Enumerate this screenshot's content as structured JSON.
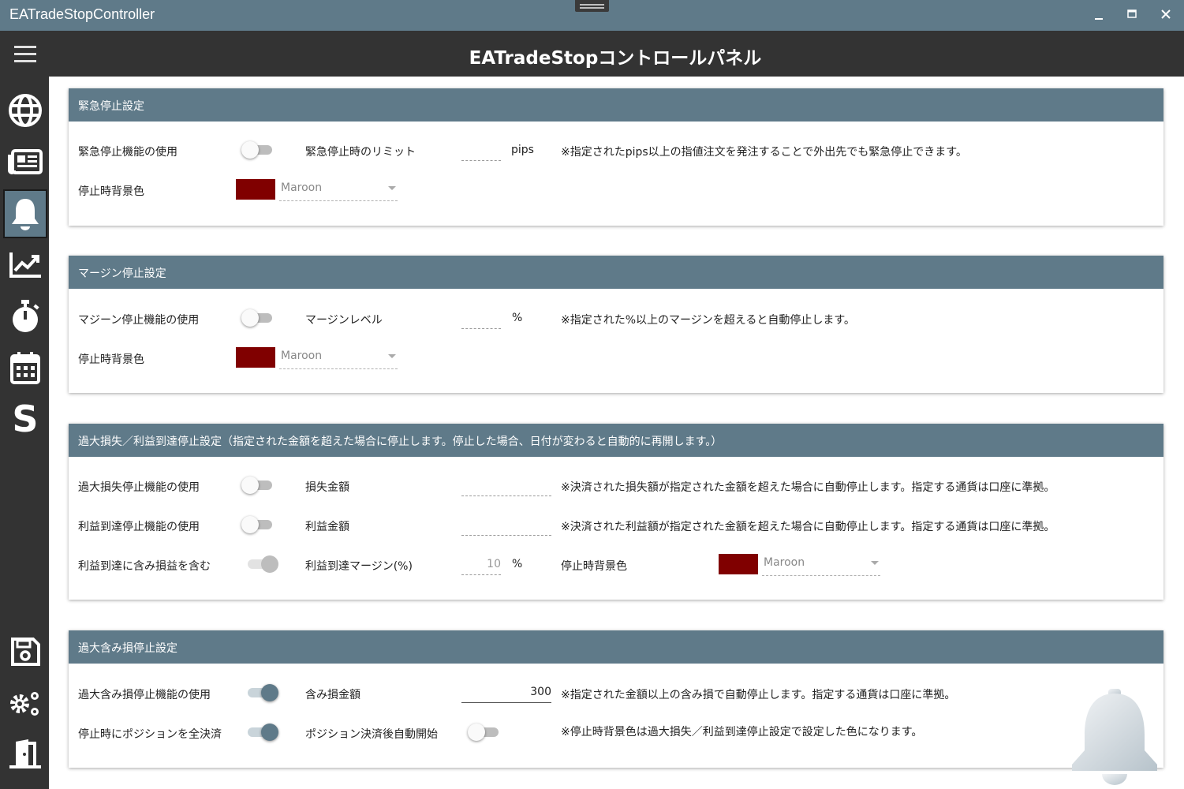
{
  "window": {
    "title": "EATradeStopController",
    "minimize": "🗕",
    "maximize": "🗖",
    "close": "✕"
  },
  "header": {
    "title": "EATradeStopコントロールパネル"
  },
  "sidebar": {
    "items": [
      {
        "icon": "globe-icon"
      },
      {
        "icon": "newspaper-icon"
      },
      {
        "icon": "bell-icon",
        "active": true
      },
      {
        "icon": "chart-line-icon"
      },
      {
        "icon": "stopwatch-icon"
      },
      {
        "icon": "calendar-icon"
      },
      {
        "icon": "s-letter-icon",
        "glyph": "S"
      }
    ],
    "bottom_items": [
      {
        "icon": "save-icon"
      },
      {
        "icon": "settings-gears-icon"
      },
      {
        "icon": "exit-door-icon"
      }
    ]
  },
  "emergency": {
    "header": "緊急停止設定",
    "use_label": "緊急停止機能の使用",
    "use_on": false,
    "limit_label": "緊急停止時のリミット",
    "limit_value": "",
    "limit_unit": "pips",
    "note": "※指定されたpips以上の指値注文を発注することで外出先でも緊急停止できます。",
    "bg_label": "停止時背景色",
    "bg_color": "#800000",
    "bg_name": "Maroon"
  },
  "margin": {
    "header": "マージン停止設定",
    "use_label": "マジーン停止機能の使用",
    "use_on": false,
    "level_label": "マージンレベル",
    "level_value": "",
    "level_unit": "%",
    "note": "※指定された%以上のマージンを超えると自動停止します。",
    "bg_label": "停止時背景色",
    "bg_color": "#800000",
    "bg_name": "Maroon"
  },
  "excess": {
    "header": "過大損失／利益到達停止設定（指定された金額を超えた場合に停止します。停止した場合、日付が変わると自動的に再開します。）",
    "loss_use_label": "過大損失停止機能の使用",
    "loss_amount_label": "損失金額",
    "loss_amount_value": "",
    "loss_note": "※決済された損失額が指定された金額を超えた場合に自動停止します。指定する通貨は口座に準拠。",
    "profit_use_label": "利益到達停止機能の使用",
    "profit_amount_label": "利益金額",
    "profit_amount_value": "",
    "profit_note": "※決済された利益額が指定された金額を超えた場合に自動停止します。指定する通貨は口座に準拠。",
    "include_label": "利益到達に含み損益を含む",
    "profit_margin_label": "利益到達マージン(%)",
    "profit_margin_value": "10",
    "profit_margin_unit": "%",
    "bg_label": "停止時背景色",
    "bg_color": "#800000",
    "bg_name": "Maroon"
  },
  "unrealized": {
    "header": "過大含み損停止設定",
    "use_label": "過大含み損停止機能の使用",
    "use_on": true,
    "amount_label": "含み損金額",
    "amount_value": "300",
    "note": "※指定された金額以上の含み損で自動停止します。指定する通貨は口座に準拠。",
    "close_all_label": "停止時にポジションを全決済",
    "close_all_on": true,
    "auto_start_label": "ポジション決済後自動開始",
    "auto_start_on": false,
    "note2": "※停止時背景色は過大損失／利益到達停止設定で設定した色になります。"
  },
  "colors": {
    "accent": "#5f7a89",
    "sidebar": "#333333",
    "maroon": "#800000"
  }
}
